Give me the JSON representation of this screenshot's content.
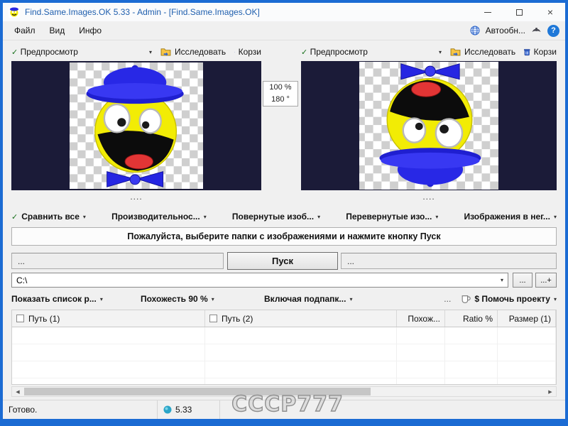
{
  "icons": {
    "check": "✓",
    "caret": "▾",
    "close": "×",
    "question": "?",
    "scroll_left": "◀",
    "scroll_right": "▶"
  },
  "window": {
    "title": "Find.Same.Images.OK 5.33 - Admin - [Find.Same.Images.OK]"
  },
  "menu": {
    "items": [
      "Файл",
      "Вид",
      "Инфо"
    ],
    "autoupdate_label": "Автообн..."
  },
  "preview_left": {
    "preview_label": "Предпросмотр",
    "explore_label": "Исследовать",
    "trash_label": "Корзи",
    "caption": "...."
  },
  "preview_right": {
    "preview_label": "Предпросмотр",
    "explore_label": "Исследовать",
    "trash_label": "Корзи",
    "caption": "...."
  },
  "zoom_panel": {
    "zoom": "100 %",
    "rotation": "180 °"
  },
  "options_row": [
    {
      "label": "Сравнить все"
    },
    {
      "label": "Производительнос..."
    },
    {
      "label": "Повернутые изоб..."
    },
    {
      "label": "Перевернутые изо..."
    },
    {
      "label": "Изображения в нег..."
    }
  ],
  "message_bar": {
    "text": "Пожалуйста, выберите папки с изображениями и нажмите кнопку Пуск"
  },
  "start_row": {
    "left_field": "...",
    "start_button": "Пуск",
    "right_field": "..."
  },
  "path_row": {
    "value": "C:\\",
    "browse_button": "...",
    "browse_add_button": "...+"
  },
  "filter_row": {
    "show_list": "Показать список р...",
    "similarity": "Похожесть 90 %",
    "subfolders": "Включая подпапк...",
    "more": "...",
    "donate": "$ Помочь проекту"
  },
  "table": {
    "columns": [
      "Путь (1)",
      "Путь (2)",
      "Похож...",
      "Ratio %",
      "Размер (1)"
    ]
  },
  "status_bar": {
    "ready": "Готово.",
    "version": "5.33",
    "watermark": "СССР777"
  }
}
